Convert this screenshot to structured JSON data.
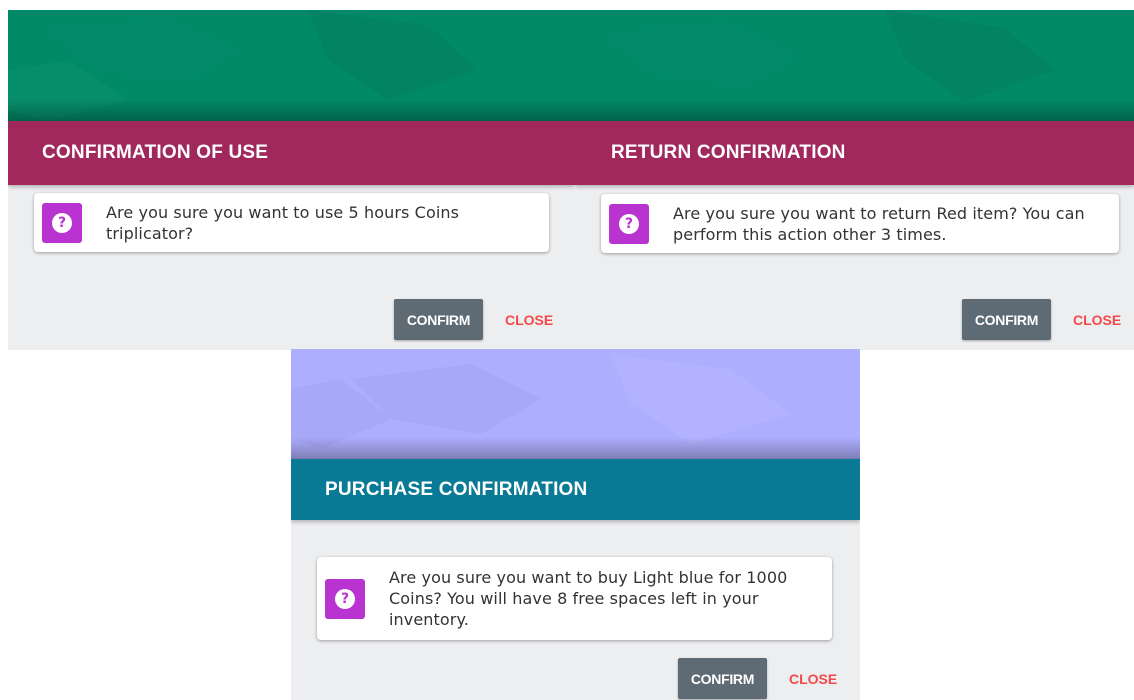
{
  "colors": {
    "green_bg": "#018a68",
    "purple_bg": "#aeaefe",
    "header_magenta": "#a0285c",
    "header_teal": "#087a95",
    "icon_purple": "#b833cf",
    "confirm_bg": "#5f6b74",
    "close_red": "#f24a4a"
  },
  "icons": {
    "question": "question-icon"
  },
  "dialogs": [
    {
      "title": "CONFIRMATION OF USE",
      "message": "Are you sure you want to use 5 hours Coins triplicator?",
      "confirm_label": "CONFIRM",
      "close_label": "CLOSE"
    },
    {
      "title": "RETURN CONFIRMATION",
      "message": "Are you sure you want to return Red item? You can perform this action other 3 times.",
      "confirm_label": "CONFIRM",
      "close_label": "CLOSE"
    },
    {
      "title": "PURCHASE CONFIRMATION",
      "message": "Are you sure you want to buy Light blue for 1000 Coins? You will have 8 free spaces left in your inventory.",
      "confirm_label": "CONFIRM",
      "close_label": "CLOSE"
    }
  ]
}
